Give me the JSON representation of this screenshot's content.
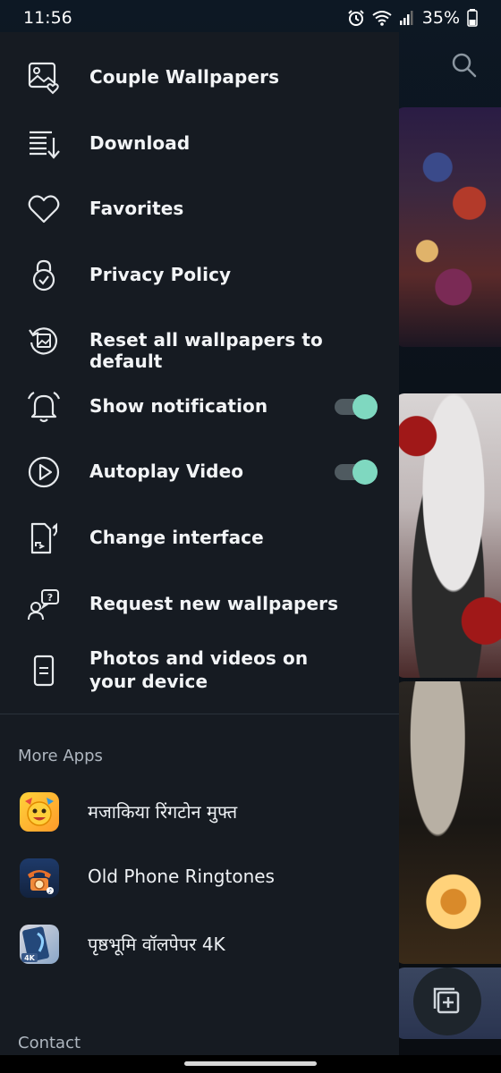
{
  "status_bar": {
    "time": "11:56",
    "battery": "35%"
  },
  "drawer": {
    "menu": [
      {
        "label": "Couple Wallpapers",
        "icon": "couple-wallpapers-icon"
      },
      {
        "label": "Download",
        "icon": "download-icon"
      },
      {
        "label": "Favorites",
        "icon": "heart-icon"
      },
      {
        "label": "Privacy Policy",
        "icon": "lock-icon"
      },
      {
        "label": "Reset all wallpapers to default",
        "icon": "reset-icon"
      },
      {
        "label": "Show notification",
        "icon": "bell-icon",
        "toggle": true
      },
      {
        "label": "Autoplay Video",
        "icon": "play-icon",
        "toggle": true
      },
      {
        "label": "Change interface",
        "icon": "change-interface-icon"
      },
      {
        "label": "Request new wallpapers",
        "icon": "request-icon"
      },
      {
        "label": "Photos and videos on your device",
        "icon": "device-icon"
      }
    ],
    "more_apps_title": "More Apps",
    "more_apps": [
      {
        "label": "मजाकिया रिंगटोन मुफ्त",
        "icon": "funny-ringtone-app-icon"
      },
      {
        "label": "Old Phone Ringtones",
        "icon": "old-phone-app-icon"
      },
      {
        "label": "पृष्ठभूमि वॉलपेपर 4K",
        "icon": "wallpaper-4k-app-icon"
      }
    ],
    "contact_title": "Contact"
  },
  "colors": {
    "drawer_bg": "#161b22",
    "toggle_on": "#7fd8c0",
    "toggle_track": "#4f5a60"
  }
}
